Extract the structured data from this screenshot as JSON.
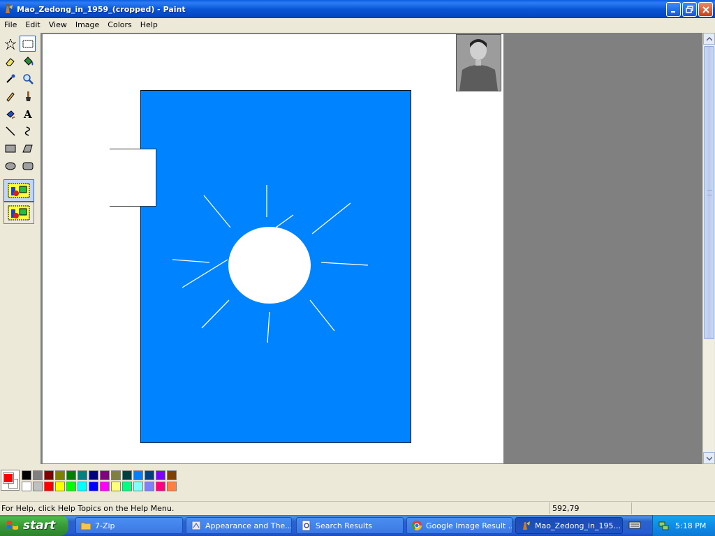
{
  "window": {
    "title": "Mao_Zedong_in_1959_(cropped) - Paint"
  },
  "menu": [
    "File",
    "Edit",
    "View",
    "Image",
    "Colors",
    "Help"
  ],
  "tools": [
    {
      "name": "free-form-select-tool",
      "icon": "star-select-icon"
    },
    {
      "name": "select-tool",
      "icon": "rect-select-icon",
      "active": true
    },
    {
      "name": "eraser-tool",
      "icon": "eraser-icon"
    },
    {
      "name": "fill-tool",
      "icon": "bucket-icon"
    },
    {
      "name": "pick-color-tool",
      "icon": "eyedropper-icon"
    },
    {
      "name": "magnifier-tool",
      "icon": "magnifier-icon"
    },
    {
      "name": "pencil-tool",
      "icon": "pencil-icon"
    },
    {
      "name": "brush-tool",
      "icon": "brush-icon"
    },
    {
      "name": "airbrush-tool",
      "icon": "airbrush-icon"
    },
    {
      "name": "text-tool",
      "icon": "text-icon"
    },
    {
      "name": "line-tool",
      "icon": "line-icon"
    },
    {
      "name": "curve-tool",
      "icon": "curve-icon"
    },
    {
      "name": "rectangle-tool",
      "icon": "rectangle-icon"
    },
    {
      "name": "polygon-tool",
      "icon": "polygon-icon"
    },
    {
      "name": "ellipse-tool",
      "icon": "ellipse-icon"
    },
    {
      "name": "rounded-rectangle-tool",
      "icon": "rounded-rect-icon"
    }
  ],
  "colors": {
    "foreground": "#ff0000",
    "background": "#ffffff",
    "canvas_fill": "#0083ff",
    "palette_top": [
      "#000000",
      "#808080",
      "#800000",
      "#808000",
      "#008000",
      "#008080",
      "#000080",
      "#800080",
      "#808040",
      "#004040",
      "#0080ff",
      "#004080",
      "#8000ff",
      "#804000"
    ],
    "palette_bottom": [
      "#ffffff",
      "#c0c0c0",
      "#ff0000",
      "#ffff00",
      "#00ff00",
      "#00ffff",
      "#0000ff",
      "#ff00ff",
      "#ffff80",
      "#00ff80",
      "#80ffff",
      "#8080ff",
      "#ff0080",
      "#ff8040"
    ]
  },
  "status": {
    "help": "For Help, click Help Topics on the Help Menu.",
    "coords": "592,79"
  },
  "taskbar": {
    "start_label": "start",
    "tasks": [
      {
        "label": "7-Zip",
        "icon": "folder-icon"
      },
      {
        "label": "Appearance and The...",
        "icon": "control-panel-icon"
      },
      {
        "label": "Search Results",
        "icon": "search-results-icon"
      },
      {
        "label": "Google Image Result ...",
        "icon": "chrome-icon"
      },
      {
        "label": "Mao_Zedong_in_195...",
        "icon": "paint-icon",
        "active": true
      }
    ],
    "clock": "5:18 PM"
  }
}
